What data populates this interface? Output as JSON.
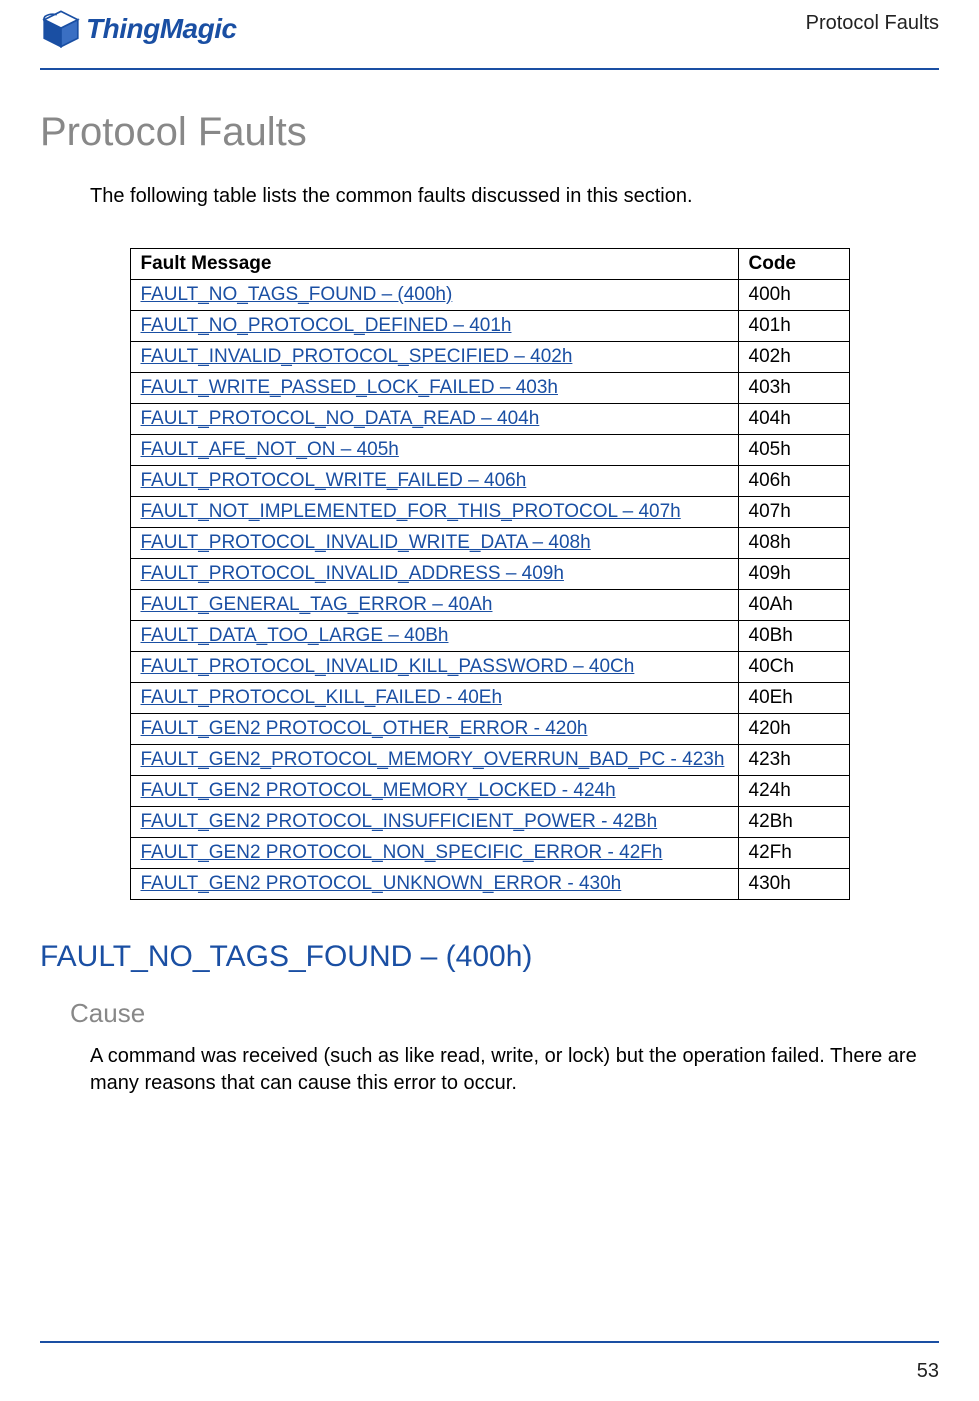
{
  "header": {
    "logo_text": "ThingMagic",
    "right_title": "Protocol Faults"
  },
  "main_title": "Protocol Faults",
  "intro": "The following table lists the common faults discussed in this section.",
  "table": {
    "header_msg": "Fault Message",
    "header_code": "Code",
    "rows": [
      {
        "msg": "FAULT_NO_TAGS_FOUND – (400h)",
        "code": "400h"
      },
      {
        "msg": "FAULT_NO_PROTOCOL_DEFINED – 401h",
        "code": "401h"
      },
      {
        "msg": "FAULT_INVALID_PROTOCOL_SPECIFIED – 402h",
        "code": "402h"
      },
      {
        "msg": "FAULT_WRITE_PASSED_LOCK_FAILED – 403h",
        "code": "403h"
      },
      {
        "msg": "FAULT_PROTOCOL_NO_DATA_READ – 404h",
        "code": "404h"
      },
      {
        "msg": "FAULT_AFE_NOT_ON – 405h",
        "code": "405h"
      },
      {
        "msg": "FAULT_PROTOCOL_WRITE_FAILED – 406h",
        "code": "406h"
      },
      {
        "msg": "FAULT_NOT_IMPLEMENTED_FOR_THIS_PROTOCOL – 407h",
        "code": "407h"
      },
      {
        "msg": "FAULT_PROTOCOL_INVALID_WRITE_DATA – 408h",
        "code": "408h"
      },
      {
        "msg": "FAULT_PROTOCOL_INVALID_ADDRESS – 409h",
        "code": "409h"
      },
      {
        "msg": "FAULT_GENERAL_TAG_ERROR – 40Ah",
        "code": "40Ah"
      },
      {
        "msg": "FAULT_DATA_TOO_LARGE – 40Bh",
        "code": "40Bh"
      },
      {
        "msg": "FAULT_PROTOCOL_INVALID_KILL_PASSWORD – 40Ch",
        "code": "40Ch"
      },
      {
        "msg": "FAULT_PROTOCOL_KILL_FAILED - 40Eh",
        "code": "40Eh"
      },
      {
        "msg": "FAULT_GEN2 PROTOCOL_OTHER_ERROR - 420h",
        "code": "420h"
      },
      {
        "msg": "FAULT_GEN2_PROTOCOL_MEMORY_OVERRUN_BAD_PC - 423h",
        "code": "423h"
      },
      {
        "msg": "FAULT_GEN2 PROTOCOL_MEMORY_LOCKED - 424h",
        "code": "424h"
      },
      {
        "msg": "FAULT_GEN2 PROTOCOL_INSUFFICIENT_POWER - 42Bh",
        "code": "42Bh"
      },
      {
        "msg": "FAULT_GEN2 PROTOCOL_NON_SPECIFIC_ERROR - 42Fh",
        "code": "42Fh"
      },
      {
        "msg": "FAULT_GEN2 PROTOCOL_UNKNOWN_ERROR - 430h",
        "code": "430h"
      }
    ]
  },
  "section": {
    "heading": "FAULT_NO_TAGS_FOUND – (400h)",
    "sub_heading": "Cause",
    "body": "A command was received (such as like read, write, or lock) but the operation failed. There are many reasons that can cause this error to occur."
  },
  "page_number": "53"
}
